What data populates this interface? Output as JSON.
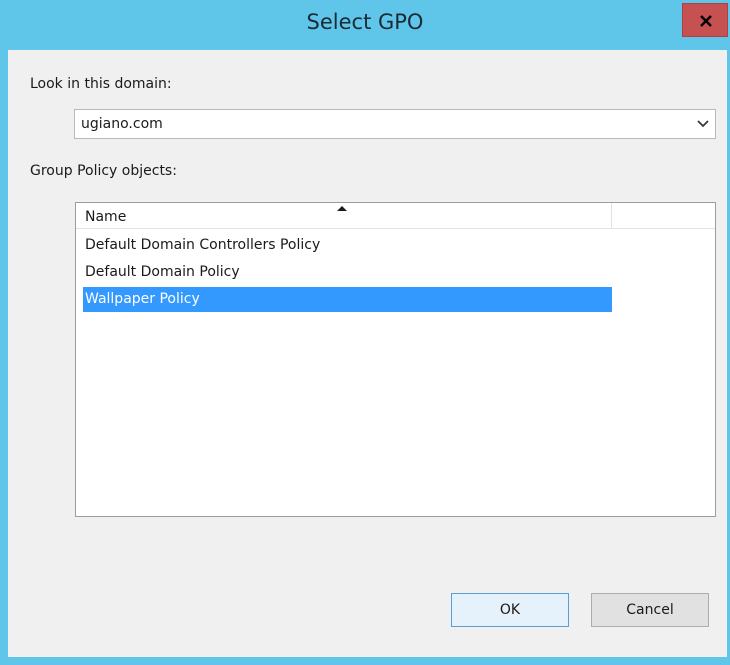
{
  "window": {
    "title": "Select GPO",
    "close_glyph": "x"
  },
  "domain": {
    "label": "Look in this domain:",
    "value": "ugiano.com"
  },
  "gpo_list": {
    "label": "Group Policy objects:",
    "column_name": "Name",
    "sort_direction": "ascending",
    "items": [
      {
        "name": "Default Domain Controllers Policy",
        "selected": false
      },
      {
        "name": "Default Domain Policy",
        "selected": false
      },
      {
        "name": "Wallpaper Policy",
        "selected": true
      }
    ]
  },
  "buttons": {
    "ok": "OK",
    "cancel": "Cancel"
  },
  "colors": {
    "titlebar": "#5fc6ea",
    "close_button": "#c75050",
    "selection": "#3399ff"
  }
}
